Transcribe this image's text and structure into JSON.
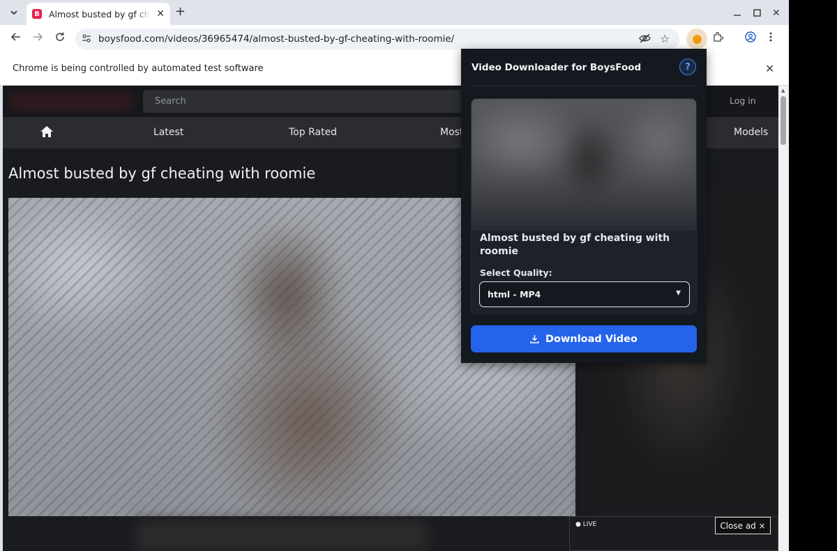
{
  "browser": {
    "tab_title": "Almost busted by gf cheating with roomie",
    "tab_favicon_letter": "B",
    "url": "boysfood.com/videos/36965474/almost-busted-by-gf-cheating-with-roomie/",
    "infobar_text": "Chrome is being controlled by automated test software"
  },
  "site": {
    "search_placeholder": "Search",
    "login_label": "Log in",
    "nav": {
      "latest": "Latest",
      "top_rated": "Top Rated",
      "most": "Most",
      "models": "Models"
    },
    "video_title": "Almost busted by gf cheating with roomie",
    "ad": {
      "live_label": "LIVE",
      "close_label": "Close ad ×"
    }
  },
  "popup": {
    "title": "Video Downloader for BoysFood",
    "help_label": "?",
    "video_title": "Almost busted by gf cheating with roomie",
    "quality_label": "Select Quality:",
    "quality_value": "html - MP4",
    "download_label": "Download Video"
  },
  "colors": {
    "accent": "#2563eb",
    "popup_bg": "#14181f",
    "page_bg": "#1a1b1f",
    "favicon": "#e91e4e"
  }
}
